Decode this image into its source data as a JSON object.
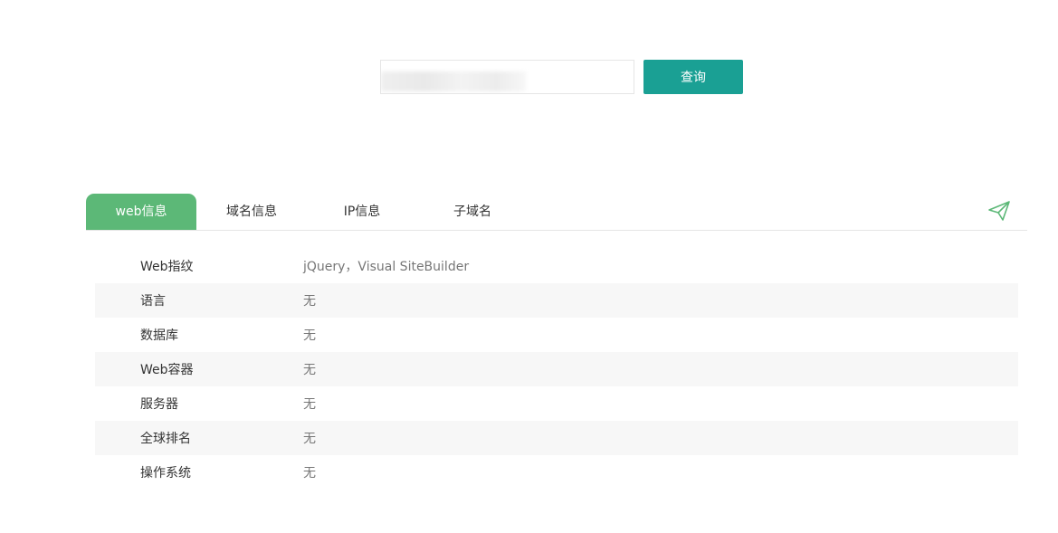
{
  "search": {
    "input_value": "",
    "button_label": "查询"
  },
  "tabs": [
    {
      "label": "web信息",
      "active": true
    },
    {
      "label": "域名信息",
      "active": false
    },
    {
      "label": "IP信息",
      "active": false
    },
    {
      "label": "子域名",
      "active": false
    }
  ],
  "colors": {
    "accent_teal": "#1aa094",
    "tab_active_green": "#5cb877",
    "icon_green": "#5cb877"
  },
  "icons": {
    "share": "paper-plane-icon"
  },
  "web_info": {
    "rows": [
      {
        "key": "Web指纹",
        "value": "jQuery，Visual SiteBuilder"
      },
      {
        "key": "语言",
        "value": "无"
      },
      {
        "key": "数据库",
        "value": "无"
      },
      {
        "key": "Web容器",
        "value": "无"
      },
      {
        "key": "服务器",
        "value": "无"
      },
      {
        "key": "全球排名",
        "value": "无"
      },
      {
        "key": "操作系统",
        "value": "无"
      }
    ]
  }
}
